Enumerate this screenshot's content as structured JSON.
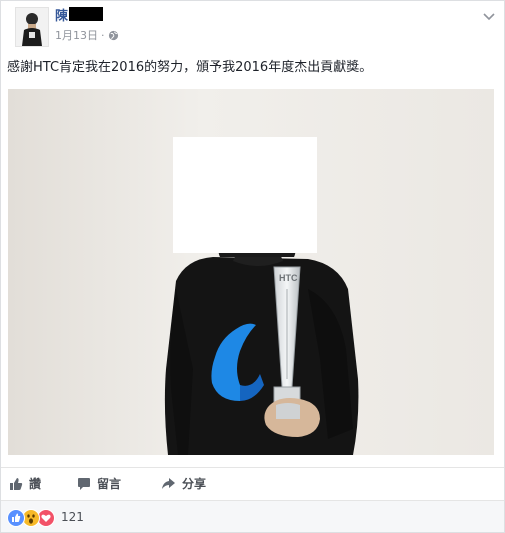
{
  "post": {
    "author_name": "陳",
    "date": "1月13日",
    "separator": "·",
    "privacy_icon": "globe-icon",
    "menu_icon": "chevron-down-icon",
    "text": "感謝HTC肯定我在2016的努力，頒予我2016年度杰出貢獻獎。"
  },
  "photo": {
    "shirt_logo_color": "#1e88e5",
    "trophy_text": "HTC"
  },
  "actions": {
    "like_label": "讚",
    "comment_label": "留言",
    "share_label": "分享"
  },
  "reactions": {
    "icons": [
      "like-icon",
      "wow-icon",
      "love-icon"
    ],
    "count": "121",
    "colors": {
      "like": "#5890ff",
      "wow": "#f7b928",
      "love": "#f25268"
    }
  }
}
